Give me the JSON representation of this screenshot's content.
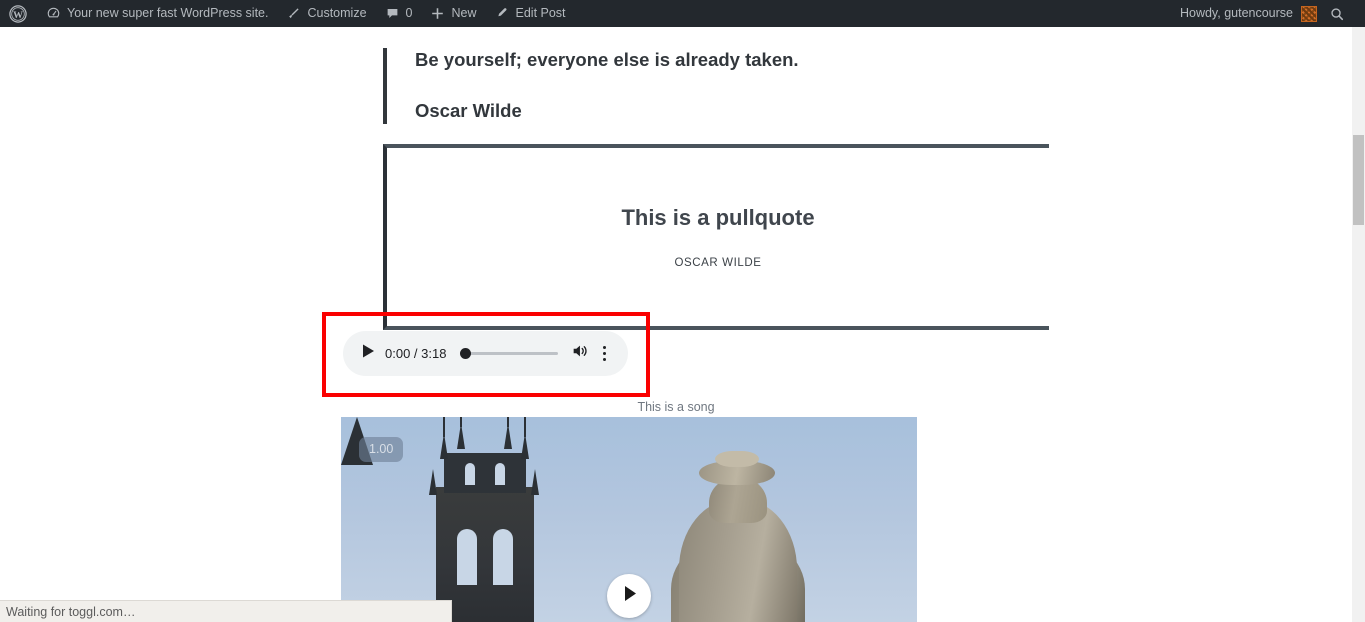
{
  "admin_bar": {
    "background": "#23282d",
    "text_color": "#b4b9be",
    "left_items": [
      {
        "name": "wp-logo",
        "icon": "wordpress-logo-icon",
        "label": ""
      },
      {
        "name": "site-name",
        "icon": "dashboard-speedometer-icon",
        "label": "Your new super fast WordPress site."
      },
      {
        "name": "customize",
        "icon": "paintbrush-icon",
        "label": "Customize"
      },
      {
        "name": "comments",
        "icon": "comment-bubble-icon",
        "label": "0"
      },
      {
        "name": "new",
        "icon": "plus-icon",
        "label": "New"
      },
      {
        "name": "edit-post",
        "icon": "pencil-icon",
        "label": "Edit Post"
      }
    ],
    "right_items": [
      {
        "name": "my-account",
        "label": "Howdy, gutencourse",
        "icon": "avatar-icon"
      },
      {
        "name": "search",
        "label": "",
        "icon": "search-icon"
      }
    ]
  },
  "content": {
    "blockquote": {
      "quote": "Be yourself; everyone else is already taken.",
      "citation": "Oscar Wilde",
      "border_color": "#32373c"
    },
    "pullquote": {
      "quote": "This is a pullquote",
      "citation": "OSCAR WILDE",
      "border_color": "#4a545c"
    },
    "audio": {
      "play_icon": "play-triangle-icon",
      "time_display": "0:00 / 3:18",
      "current_time": "0:00",
      "duration": "3:18",
      "volume_icon": "volume-high-icon",
      "menu_icon": "more-vertical-icon",
      "background": "#f1f3f4",
      "caption": "This is a song"
    },
    "video": {
      "playback_rate_badge": "1.00",
      "play_icon": "play-triangle-icon",
      "poster_description": "gothic cathedral tower and stone statue against a pale blue sky"
    },
    "highlight": {
      "name": "audio-block-highlight",
      "color": "#fa0000"
    }
  },
  "browser": {
    "status_text": "Waiting for toggl.com…",
    "scrollbar": {
      "track_color": "#f1f1f1",
      "thumb_color": "#c1c1c1"
    }
  }
}
